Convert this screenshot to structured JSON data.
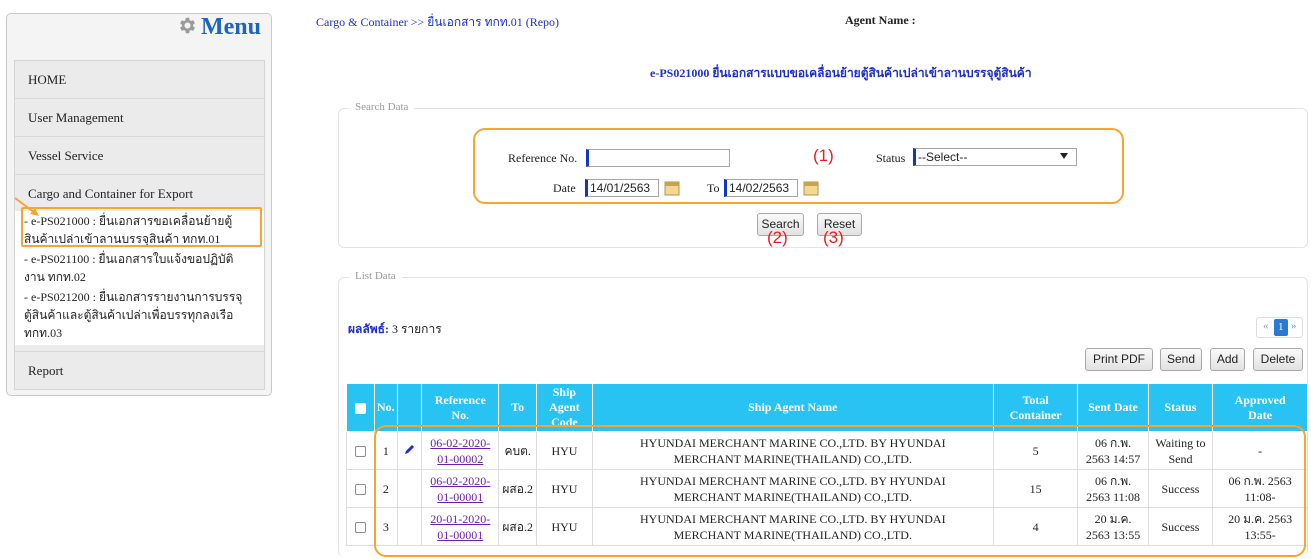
{
  "sidebar": {
    "title": "Menu",
    "items": [
      {
        "label": "HOME"
      },
      {
        "label": "User Management"
      },
      {
        "label": "Vessel Service"
      },
      {
        "label": "Cargo and Container for Export"
      }
    ],
    "submenu": [
      {
        "line1": "-   e-PS021000 : ยื่นเอกสารขอเคลื่อนย้ายตู้",
        "line2": "สินค้าเปล่าเข้าลานบรรจุสินค้า ทกท.01"
      },
      {
        "line1": "-   e-PS021100 : ยื่นเอกสารใบแจ้งขอปฏิบัติ",
        "line2": "งาน ทกท.02"
      },
      {
        "line1": "-   e-PS021200 : ยื่นเอกสารรายงานการบรรจุ",
        "line2": "ตู้สินค้าและตู้สินค้าเปล่าเพื่อบรรทุกลงเรือ",
        "line3": "ทกท.03"
      }
    ],
    "report": "Report"
  },
  "header": {
    "breadcrumb": "Cargo & Container >> ยื่นเอกสาร ทกท.01 (Repo)",
    "agent_label": "Agent Name :",
    "page_title": "e-PS021000 ยื่นเอกสารแบบขอเคลื่อนย้ายตู้สินค้าเปล่าเข้าลานบรรจุตู้สินค้า"
  },
  "search": {
    "legend": "Search Data",
    "ref_label": "Reference No.",
    "ref_value": "",
    "status_label": "Status",
    "status_value": "--Select--",
    "date_label": "Date",
    "date_from": "14/01/2563",
    "to_label": "To",
    "date_to": "14/02/2563",
    "search_btn": "Search",
    "reset_btn": "Reset",
    "marker1": "(1)",
    "marker2": "(2)",
    "marker3": "(3)"
  },
  "list": {
    "legend": "List Data",
    "result_key": "ผลลัพธ์:",
    "result_value": " 3 รายการ",
    "pager": {
      "prev": "«",
      "page": "1",
      "next": "»"
    },
    "actions": {
      "print": "Print PDF",
      "send": "Send",
      "add": "Add",
      "delete": "Delete"
    },
    "headers": {
      "no": "No.",
      "ref": [
        "Reference",
        "No."
      ],
      "to": "To",
      "code": [
        "Ship Agent",
        "Code"
      ],
      "name": "Ship Agent Name",
      "total": [
        "Total",
        "Container"
      ],
      "sent": "Sent Date",
      "status": "Status",
      "approved": [
        "Approved",
        "Date"
      ]
    },
    "rows": [
      {
        "no": "1",
        "ref1": "06-02-2020-",
        "ref2": "01-00002",
        "to": "คบต.",
        "code": "HYU",
        "name1": "HYUNDAI MERCHANT MARINE CO.,LTD. BY HYUNDAI",
        "name2": "MERCHANT MARINE(THAILAND) CO.,LTD.",
        "total": "5",
        "sent1": "06 ก.พ.",
        "sent2": "2563 14:57",
        "status1": "Waiting to",
        "status2": "Send",
        "appr1": "-",
        "appr2": ""
      },
      {
        "no": "2",
        "ref1": "06-02-2020-",
        "ref2": "01-00001",
        "to": "ผสอ.2",
        "code": "HYU",
        "name1": "HYUNDAI MERCHANT MARINE CO.,LTD. BY HYUNDAI",
        "name2": "MERCHANT MARINE(THAILAND) CO.,LTD.",
        "total": "15",
        "sent1": "06 ก.พ.",
        "sent2": "2563 11:08",
        "status1": "Success",
        "status2": "",
        "appr1": "06 ก.พ. 2563",
        "appr2": "11:08-"
      },
      {
        "no": "3",
        "ref1": "20-01-2020-",
        "ref2": "01-00001",
        "to": "ผสอ.2",
        "code": "HYU",
        "name1": "HYUNDAI MERCHANT MARINE CO.,LTD. BY HYUNDAI",
        "name2": "MERCHANT MARINE(THAILAND) CO.,LTD.",
        "total": "4",
        "sent1": "20 ม.ค.",
        "sent2": "2563 13:55",
        "status1": "Success",
        "status2": "",
        "appr1": "20 ม.ค. 2563",
        "appr2": "13:55-"
      }
    ]
  },
  "colors": {
    "accent_blue": "#1d2fc8",
    "header_cyan": "#29c3f3",
    "highlight_orange": "#f5a530",
    "marker_red": "#e8201f"
  },
  "icons": {
    "menu": "gear-icon",
    "calendar": "calendar-icon",
    "edit": "pencil-icon",
    "pointer": "arrow-icon"
  }
}
